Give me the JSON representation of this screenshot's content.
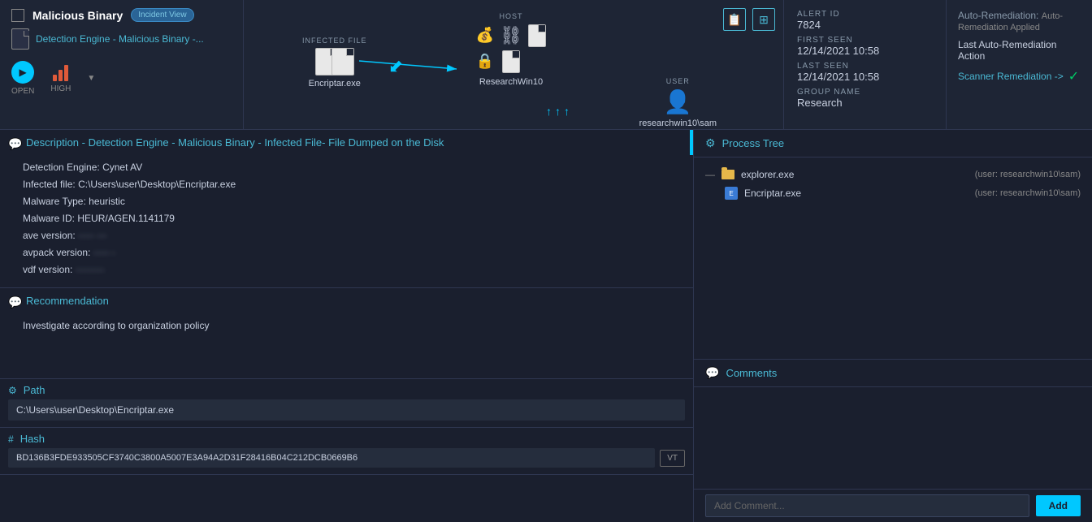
{
  "header": {
    "title": "Malicious Binary",
    "badge": "Incident View",
    "detection_link": "Detection Engine - Malicious Binary -...",
    "actions": {
      "open_label": "OPEN",
      "high_label": "HIGH"
    },
    "infected_file_label": "INFECTED FILE",
    "infected_file_name": "Encriptar.exe",
    "host_label": "HOST",
    "host_name": "ResearchWin10",
    "user_label": "USER",
    "user_name": "researchwin10\\sam",
    "alert_id_label": "ALERT ID",
    "alert_id_value": "7824",
    "first_seen_label": "FIRST SEEN",
    "first_seen_value": "12/14/2021 10:58",
    "last_seen_label": "LAST SEEN",
    "last_seen_value": "12/14/2021 10:58",
    "group_name_label": "GROUP NAME",
    "group_name_value": "Research",
    "auto_remediation_label": "Auto-Remediation:",
    "auto_remediation_value": "Auto-Remediation Applied",
    "last_action_label": "Last Auto-Remediation Action",
    "scanner_link": "Scanner Remediation ->"
  },
  "description": {
    "title": "Description - Detection Engine - Malicious Binary - Infected File- File Dumped on the Disk",
    "engine_label": "Detection Engine:",
    "engine_value": "Cynet AV",
    "infected_label": "Infected file:",
    "infected_value": "C:\\Users\\user\\Desktop\\Encriptar.exe",
    "malware_type_label": "Malware Type:",
    "malware_type_value": "heuristic",
    "malware_id_label": "Malware ID:",
    "malware_id_value": "HEUR/AGEN.1141179",
    "ave_label": "ave version:",
    "ave_value": "·····  ···",
    "avpack_label": "avpack version:",
    "avpack_value": "·····  ·",
    "vdf_label": "vdf version:",
    "vdf_value": "·········"
  },
  "recommendation": {
    "title": "Recommendation",
    "text": "Investigate according to organization policy"
  },
  "path": {
    "title": "Path",
    "value": "C:\\Users\\user\\Desktop\\Encriptar.exe"
  },
  "hash": {
    "title": "Hash",
    "value": "BD136B3FDE933505CF3740C3800A5007E3A94A2D31F28416B04C212DCB0669B6",
    "vt_label": "VT"
  },
  "process_tree": {
    "title": "Process Tree",
    "items": [
      {
        "name": "explorer.exe",
        "user": "(user: researchwin10\\sam)",
        "type": "folder",
        "level": 0
      },
      {
        "name": "Encriptar.exe",
        "user": "(user: researchwin10\\sam)",
        "type": "app",
        "level": 1
      }
    ]
  },
  "comments": {
    "title": "Comments",
    "placeholder": "Add Comment...",
    "add_button_label": "Add"
  }
}
